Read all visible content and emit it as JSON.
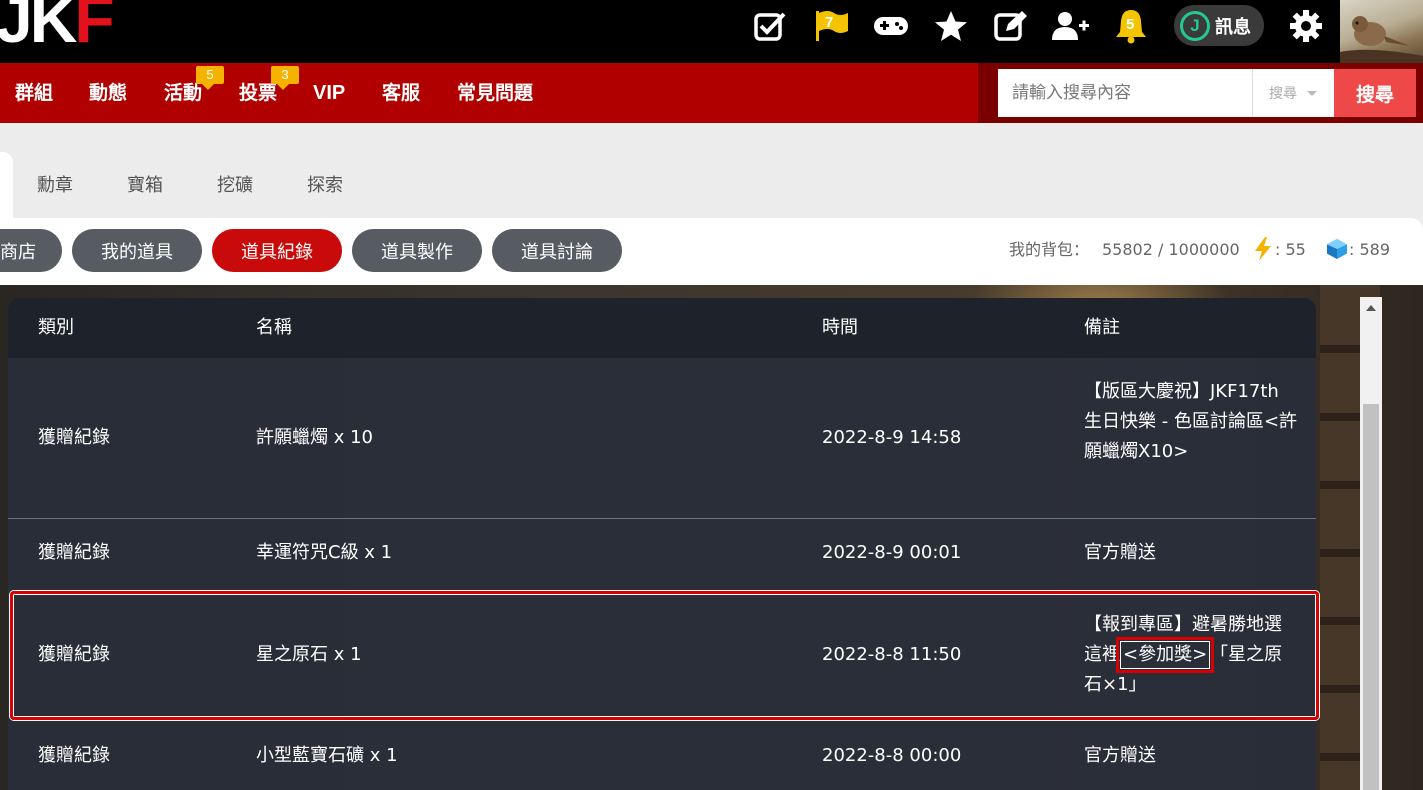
{
  "logo": {
    "part1": "JK",
    "part2": "F"
  },
  "topbar": {
    "flag_badge": "7",
    "bell_badge": "5",
    "messages_label": "訊息",
    "messages_logo": "J"
  },
  "nav": {
    "items": [
      {
        "label": "群組"
      },
      {
        "label": "動態"
      },
      {
        "label": "活動",
        "badge": "5"
      },
      {
        "label": "投票",
        "badge": "3"
      },
      {
        "label": "VIP"
      },
      {
        "label": "客服"
      },
      {
        "label": "常見問題"
      }
    ],
    "search_placeholder": "請輸入搜尋內容",
    "search_select": "搜尋",
    "search_button": "搜尋"
  },
  "subtabs": [
    "勳章",
    "寶箱",
    "挖礦",
    "探索"
  ],
  "pills": [
    "商店",
    "我的道具",
    "道具紀錄",
    "道具製作",
    "道具討論"
  ],
  "bag": {
    "label": "我的背包：",
    "value": "55802 / 1000000",
    "energy": ": 55",
    "gems": ": 589"
  },
  "table": {
    "headers": [
      "類別",
      "名稱",
      "時間",
      "備註"
    ],
    "rows": [
      {
        "type": "獲贈紀錄",
        "name": "許願蠟燭 x 10",
        "time": "2022-8-9 14:58",
        "note": "【版區大慶祝】JKF17th 生日快樂 - 色區討論區<許願蠟燭X10>"
      },
      {
        "type": "獲贈紀錄",
        "name": "幸運符咒C級 x 1",
        "time": "2022-8-9 00:01",
        "note": "官方贈送"
      },
      {
        "type": "獲贈紀錄",
        "name": "星之原石 x 1",
        "time": "2022-8-8 11:50",
        "note_pre": "【報到專區】避暑勝地選這裡",
        "note_tag": "<參加獎>",
        "note_post": "「星之原石×1」"
      },
      {
        "type": "獲贈紀錄",
        "name": "小型藍寶石礦 x 1",
        "time": "2022-8-8 00:00",
        "note": "官方贈送"
      }
    ]
  },
  "colors": {
    "brand_red": "#b10000",
    "accent_red": "#c80a0a",
    "search_red": "#ef4848",
    "badge_yellow": "#f5b300"
  }
}
